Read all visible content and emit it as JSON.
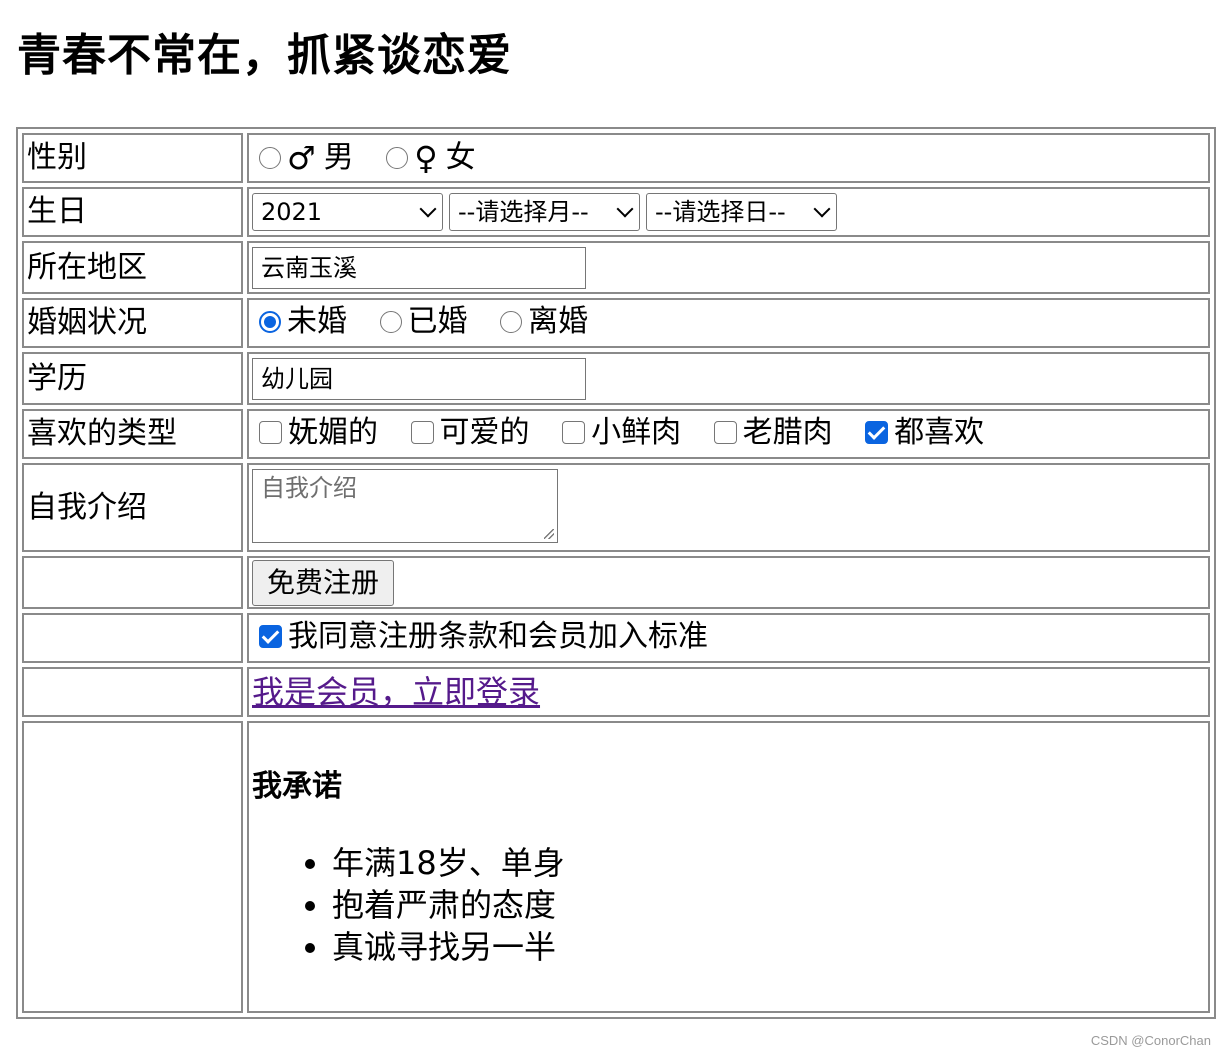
{
  "page": {
    "title": "青春不常在，抓紧谈恋爱",
    "watermark": "CSDN @ConorChan"
  },
  "form": {
    "gender": {
      "label": "性别",
      "options": [
        {
          "symbol": "♂",
          "label": "男",
          "checked": false
        },
        {
          "symbol": "♀",
          "label": "女",
          "checked": false
        }
      ]
    },
    "birthday": {
      "label": "生日",
      "year": "2021",
      "month": "--请选择月--",
      "day": "--请选择日--"
    },
    "region": {
      "label": "所在地区",
      "value": "云南玉溪"
    },
    "marital_status": {
      "label": "婚姻状况",
      "options": [
        {
          "label": "未婚",
          "checked": true
        },
        {
          "label": "已婚",
          "checked": false
        },
        {
          "label": "离婚",
          "checked": false
        }
      ]
    },
    "education": {
      "label": "学历",
      "value": "幼儿园"
    },
    "preferred_type": {
      "label": "喜欢的类型",
      "options": [
        {
          "label": "妩媚的",
          "checked": false
        },
        {
          "label": "可爱的",
          "checked": false
        },
        {
          "label": "小鲜肉",
          "checked": false
        },
        {
          "label": "老腊肉",
          "checked": false
        },
        {
          "label": "都喜欢",
          "checked": true
        }
      ]
    },
    "intro": {
      "label": "自我介绍",
      "placeholder": "自我介绍"
    },
    "register_button": "免费注册",
    "agree": {
      "label": "我同意注册条款和会员加入标准",
      "checked": true
    },
    "login_link": "我是会员，立即登录",
    "promise": {
      "title": "我承诺",
      "items": [
        "年满18岁、单身",
        "抱着严肃的态度",
        "真诚寻找另一半"
      ]
    }
  },
  "colors": {
    "accent": "#0a64e0",
    "link_visited": "#551a8b",
    "border": "#8a8a8a"
  }
}
